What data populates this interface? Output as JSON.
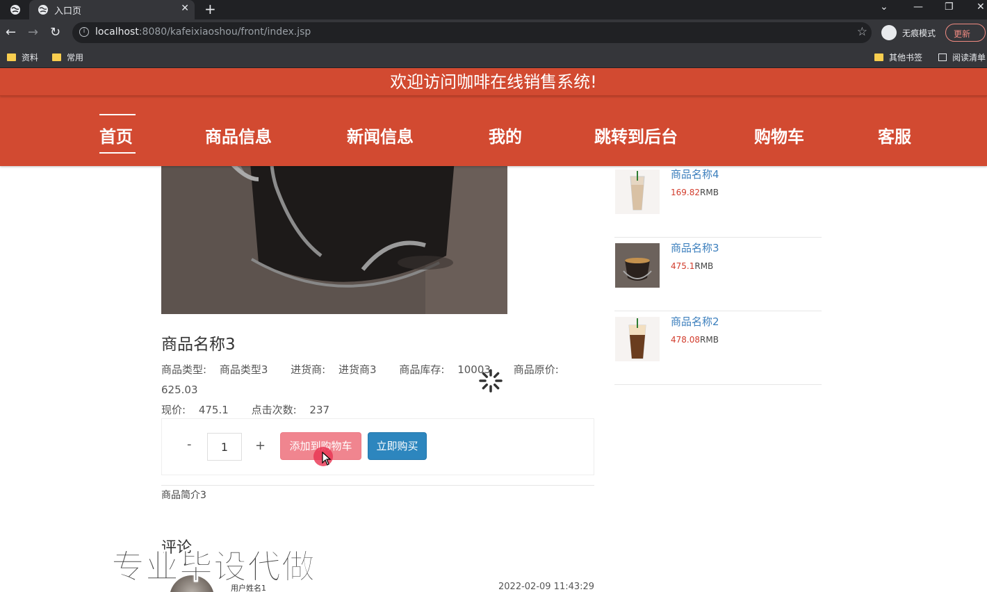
{
  "browser": {
    "tab_title": "入口页",
    "url_host": "localhost",
    "url_rest": ":8080/kafeixiaoshou/front/index.jsp",
    "incognito_label": "无痕模式",
    "update_label": "更新",
    "bookmarks": [
      "资料",
      "常用"
    ],
    "bookmarks_right": [
      "其他书签",
      "阅读清单"
    ]
  },
  "header": {
    "welcome": "欢迎访问咖啡在线销售系统!",
    "nav": [
      "首页",
      "商品信息",
      "新闻信息",
      "我的",
      "跳转到后台",
      "购物车",
      "客服"
    ],
    "active_nav": "首页"
  },
  "product": {
    "title": "商品名称3",
    "type_label": "商品类型:",
    "type_value": "商品类型3",
    "supplier_label": "进货商:",
    "supplier_value": "进货商3",
    "stock_label": "商品库存:",
    "stock_value": "10003",
    "orig_price_label": "商品原价:",
    "orig_price_value": "625.03",
    "price_label": "现价:",
    "price_value": "475.1",
    "clicks_label": "点击次数:",
    "clicks_value": "237",
    "quantity": "1",
    "minus": "-",
    "plus": "+",
    "add_cart": "添加到购物车",
    "buy_now": "立即购买",
    "description": "商品简介3"
  },
  "comments": {
    "title": "评论",
    "items": [
      {
        "user": "用户姓名1",
        "time": "2022-02-09 11:43:29"
      }
    ]
  },
  "sidebar": {
    "items": [
      {
        "name": "商品名称4",
        "price": "169.82",
        "unit": "RMB",
        "icon": "iced-latte"
      },
      {
        "name": "商品名称3",
        "price": "475.1",
        "unit": "RMB",
        "icon": "espresso-glass"
      },
      {
        "name": "商品名称2",
        "price": "478.08",
        "unit": "RMB",
        "icon": "iced-coffee"
      }
    ]
  },
  "watermark": "专业毕设代做",
  "colors": {
    "header": "#d24a31",
    "buy_button": "#2d86be",
    "cart_button": "#f0858f",
    "price": "#d23c2c",
    "link": "#3c7fbd"
  }
}
